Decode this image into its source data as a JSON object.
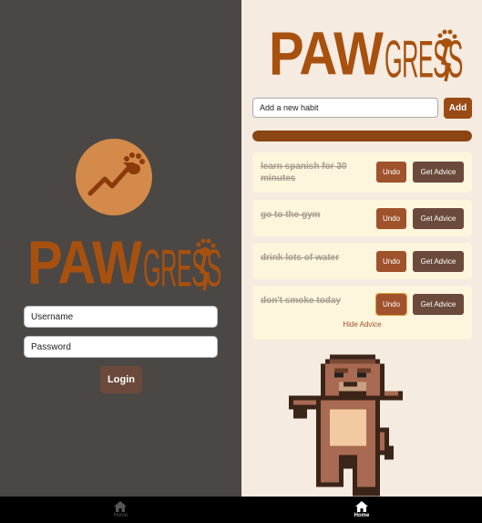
{
  "login_screen": {
    "brand": {
      "part1": "PAW",
      "part2": "GRESS"
    },
    "username_placeholder": "Username",
    "password_placeholder": "Password",
    "login_label": "Login",
    "tab_home": "Home"
  },
  "habits_screen": {
    "brand": {
      "part1": "PAW",
      "part2": "GRESS"
    },
    "new_habit_placeholder": "Add a new habit",
    "add_label": "Add",
    "progress": 1.0,
    "habits": [
      {
        "text": "learn spanish for 30 minutes",
        "undo": "Undo",
        "advice": "Get Advice"
      },
      {
        "text": "go to the gym",
        "undo": "Undo",
        "advice": "Get Advice"
      },
      {
        "text": "drink lots of water",
        "undo": "Undo",
        "advice": "Get Advice"
      },
      {
        "text": "don't smoke today",
        "undo": "Undo",
        "advice": "Get Advice"
      }
    ],
    "hide_advice_label": "Hide Advice",
    "tab_home": "Home"
  },
  "colors": {
    "brand": "#a8510f",
    "left_bg": "#4b4744",
    "right_bg": "#f5ebe0",
    "progress": "#8b4513"
  }
}
